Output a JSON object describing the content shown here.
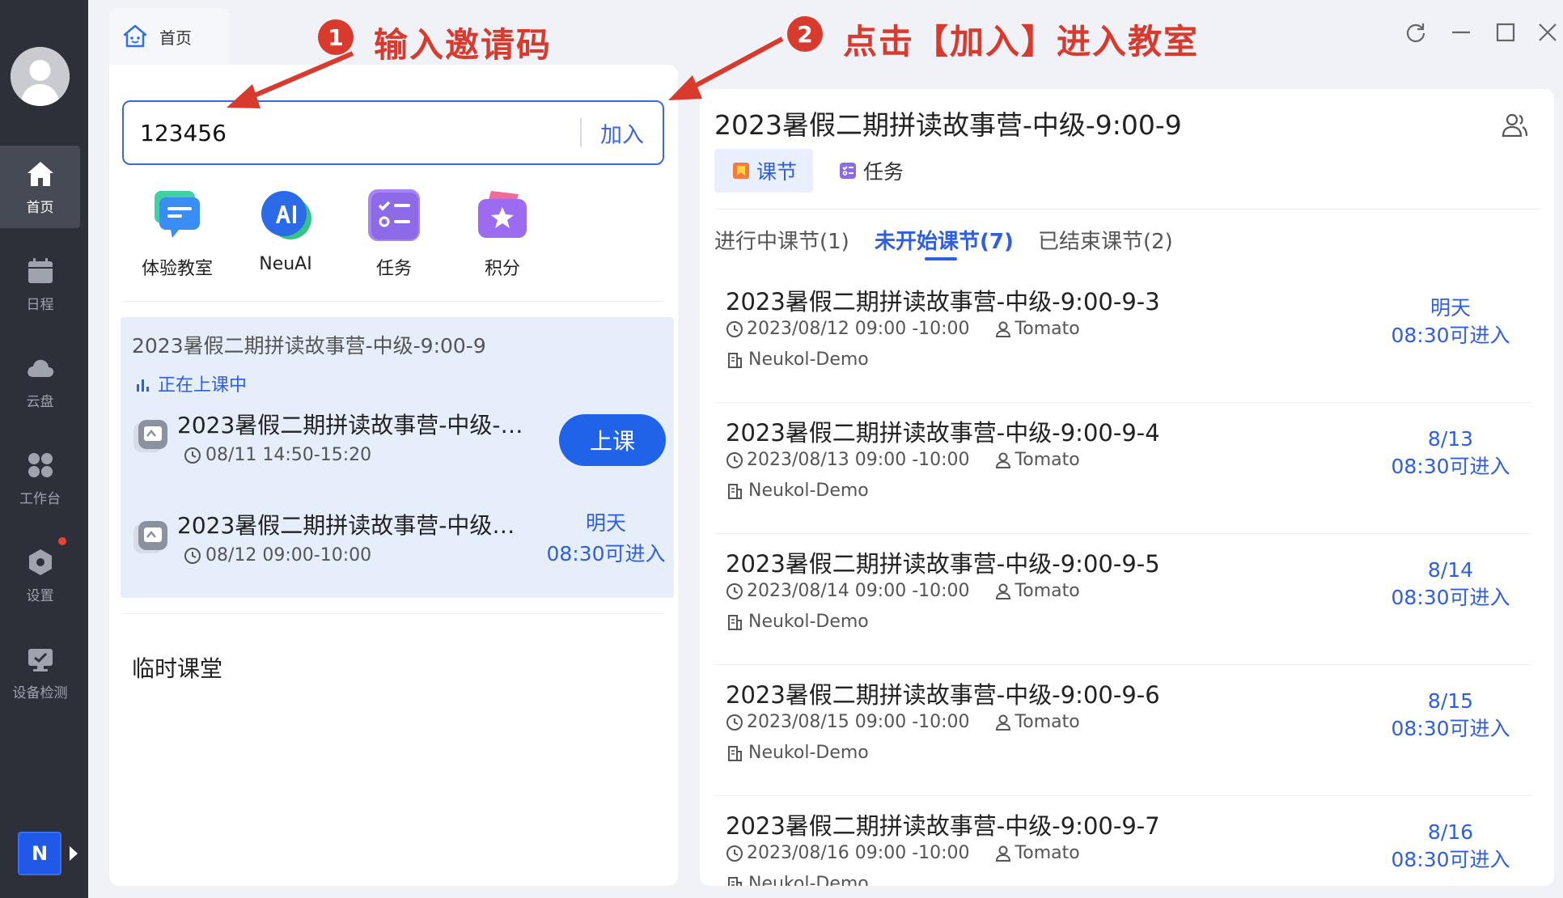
{
  "window": {
    "home_tab": "首页"
  },
  "annotations": {
    "step1_num": "1",
    "step1_text": "输入邀请码",
    "step2_num": "2",
    "step2_text": "点击【加入】进入教室"
  },
  "sidebar": {
    "items": [
      {
        "label": "首页",
        "icon": "home-icon"
      },
      {
        "label": "日程",
        "icon": "calendar-icon"
      },
      {
        "label": "云盘",
        "icon": "cloud-icon"
      },
      {
        "label": "工作台",
        "icon": "apps-icon"
      },
      {
        "label": "设置",
        "icon": "settings-icon"
      },
      {
        "label": "设备检测",
        "icon": "device-check-icon"
      }
    ],
    "logo_letter": "N"
  },
  "join": {
    "code_value": "123456",
    "join_label": "加入"
  },
  "quick_actions": [
    {
      "label": "体验教室",
      "icon": "trial-classroom-icon"
    },
    {
      "label": "NeuAI",
      "icon": "ai-icon"
    },
    {
      "label": "任务",
      "icon": "task-icon"
    },
    {
      "label": "积分",
      "icon": "points-icon"
    }
  ],
  "current_class": {
    "title": "2023暑假二期拼读故事营-中级-9:00-9",
    "status": "正在上课中",
    "lessons": [
      {
        "name": "2023暑假二期拼读故事营-中级-…",
        "time": "08/11 14:50-15:20",
        "button": "上课"
      },
      {
        "name": "2023暑假二期拼读故事营-中级…",
        "time": "08/12 09:00-10:00",
        "note_line1": "明天",
        "note_line2": "08:30可进入"
      }
    ]
  },
  "temp_class": {
    "title": "临时课堂"
  },
  "detail": {
    "title": "2023暑假二期拼读故事营-中级-9:00-9",
    "segments": [
      "课节",
      "任务"
    ],
    "tabs": [
      "进行中课节(1)",
      "未开始课节(7)",
      "已结束课节(2)"
    ],
    "lessons": [
      {
        "name": "2023暑假二期拼读故事营-中级-9:00-9-3",
        "time": "2023/08/12 09:00 -10:00",
        "teacher": "Tomato",
        "org": "Neukol-Demo",
        "enter_line1": "明天",
        "enter_line2": "08:30可进入"
      },
      {
        "name": "2023暑假二期拼读故事营-中级-9:00-9-4",
        "time": "2023/08/13 09:00 -10:00",
        "teacher": "Tomato",
        "org": "Neukol-Demo",
        "enter_line1": "8/13",
        "enter_line2": "08:30可进入"
      },
      {
        "name": "2023暑假二期拼读故事营-中级-9:00-9-5",
        "time": "2023/08/14 09:00 -10:00",
        "teacher": "Tomato",
        "org": "Neukol-Demo",
        "enter_line1": "8/14",
        "enter_line2": "08:30可进入"
      },
      {
        "name": "2023暑假二期拼读故事营-中级-9:00-9-6",
        "time": "2023/08/15 09:00 -10:00",
        "teacher": "Tomato",
        "org": "Neukol-Demo",
        "enter_line1": "8/15",
        "enter_line2": "08:30可进入"
      },
      {
        "name": "2023暑假二期拼读故事营-中级-9:00-9-7",
        "time": "2023/08/16 09:00 -10:00",
        "teacher": "Tomato",
        "org": "Neukol-Demo",
        "enter_line1": "8/16",
        "enter_line2": "08:30可进入"
      }
    ]
  },
  "colors": {
    "accent": "#2f5fe0",
    "annotation": "#d83a2e",
    "sidebar_bg": "#2d3038"
  }
}
